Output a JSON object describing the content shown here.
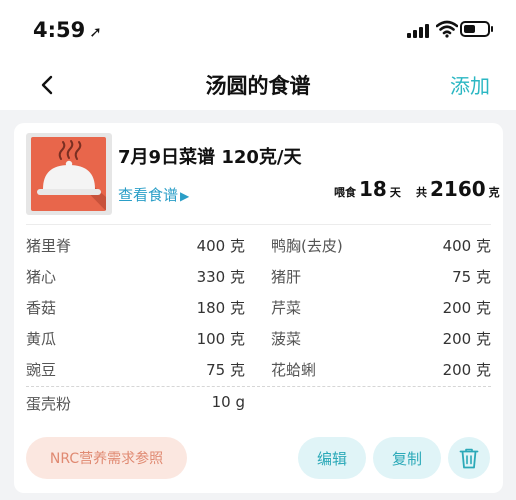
{
  "status_bar": {
    "time": "4:59"
  },
  "nav": {
    "title": "汤圆的食谱",
    "add_label": "添加"
  },
  "recipe": {
    "title": "7月9日菜谱 120克/天",
    "view_link": "查看食谱",
    "days_label": "喂食",
    "days_value": "18",
    "days_unit": "天",
    "total_label": "共",
    "total_value": "2160",
    "total_unit": "克"
  },
  "ingredients": [
    {
      "name": "猪里脊",
      "amount": "400 克"
    },
    {
      "name": "鸭胸(去皮)",
      "amount": "400 克"
    },
    {
      "name": "猪心",
      "amount": "330 克"
    },
    {
      "name": "猪肝",
      "amount": "75 克"
    },
    {
      "name": "香菇",
      "amount": "180 克"
    },
    {
      "name": "芹菜",
      "amount": "200 克"
    },
    {
      "name": "黄瓜",
      "amount": "100 克"
    },
    {
      "name": "菠菜",
      "amount": "200 克"
    },
    {
      "name": "豌豆",
      "amount": "75 克"
    },
    {
      "name": "花蛤蜊",
      "amount": "200 克"
    },
    {
      "name": "蛋壳粉",
      "amount": "10 g"
    }
  ],
  "actions": {
    "nrc_label": "NRC营养需求参照",
    "edit_label": "编辑",
    "copy_label": "复制"
  },
  "colors": {
    "accent": "#2bb7c3",
    "link": "#2a9ec7",
    "thumb_bg": "#e8664b",
    "nrc_bg": "#fbe7e0",
    "nrc_text": "#e08a72"
  }
}
